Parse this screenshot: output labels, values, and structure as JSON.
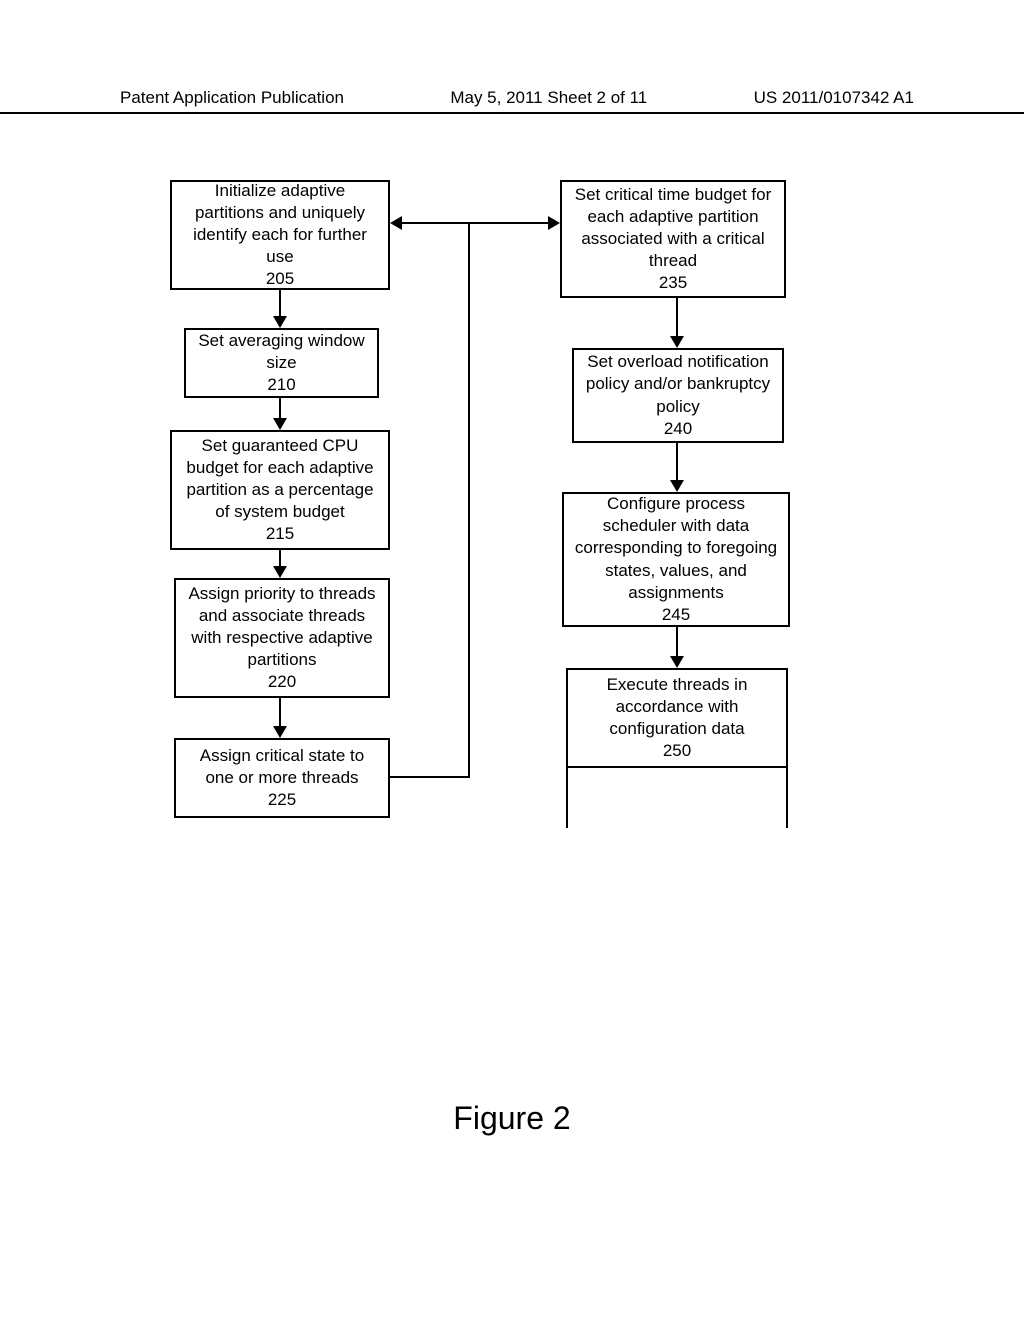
{
  "header": {
    "left": "Patent Application Publication",
    "mid": "May 5, 2011  Sheet 2 of 11",
    "right": "US 2011/0107342 A1"
  },
  "boxes": {
    "b205": "Initialize adaptive partitions and uniquely identify each for further use\n205",
    "b210": "Set averaging window size\n210",
    "b215": "Set guaranteed CPU budget for each adaptive partition as a percentage of system budget\n215",
    "b220": "Assign priority to threads and associate threads with respective adaptive partitions\n220",
    "b225": "Assign critical state to one or more threads\n225",
    "b235": "Set critical time budget for each adaptive partition associated with a critical thread\n235",
    "b240": "Set overload notification policy and/or bankruptcy policy\n240",
    "b245": "Configure process scheduler with data corresponding to foregoing states, values, and assignments\n245",
    "b250": "Execute threads in accordance with configuration data\n250"
  },
  "figure_label": "Figure 2",
  "chart_data": {
    "type": "flowchart",
    "nodes": [
      {
        "id": "205",
        "label": "Initialize adaptive partitions and uniquely identify each for further use"
      },
      {
        "id": "210",
        "label": "Set averaging window size"
      },
      {
        "id": "215",
        "label": "Set guaranteed CPU budget for each adaptive partition as a percentage of system budget"
      },
      {
        "id": "220",
        "label": "Assign priority to threads and associate threads with respective adaptive partitions"
      },
      {
        "id": "225",
        "label": "Assign critical state to one or more threads"
      },
      {
        "id": "235",
        "label": "Set critical time budget for each adaptive partition associated with a critical thread"
      },
      {
        "id": "240",
        "label": "Set overload notification policy and/or bankruptcy policy"
      },
      {
        "id": "245",
        "label": "Configure process scheduler with data corresponding to foregoing states, values, and assignments"
      },
      {
        "id": "250",
        "label": "Execute threads in accordance with configuration data"
      }
    ],
    "edges": [
      {
        "from": "205",
        "to": "210"
      },
      {
        "from": "210",
        "to": "215"
      },
      {
        "from": "215",
        "to": "220"
      },
      {
        "from": "220",
        "to": "225"
      },
      {
        "from": "225",
        "to": "235"
      },
      {
        "from": "235",
        "to": "205",
        "note": "branch back to start via connector"
      },
      {
        "from": "235",
        "to": "240"
      },
      {
        "from": "240",
        "to": "245"
      },
      {
        "from": "245",
        "to": "250"
      }
    ]
  }
}
